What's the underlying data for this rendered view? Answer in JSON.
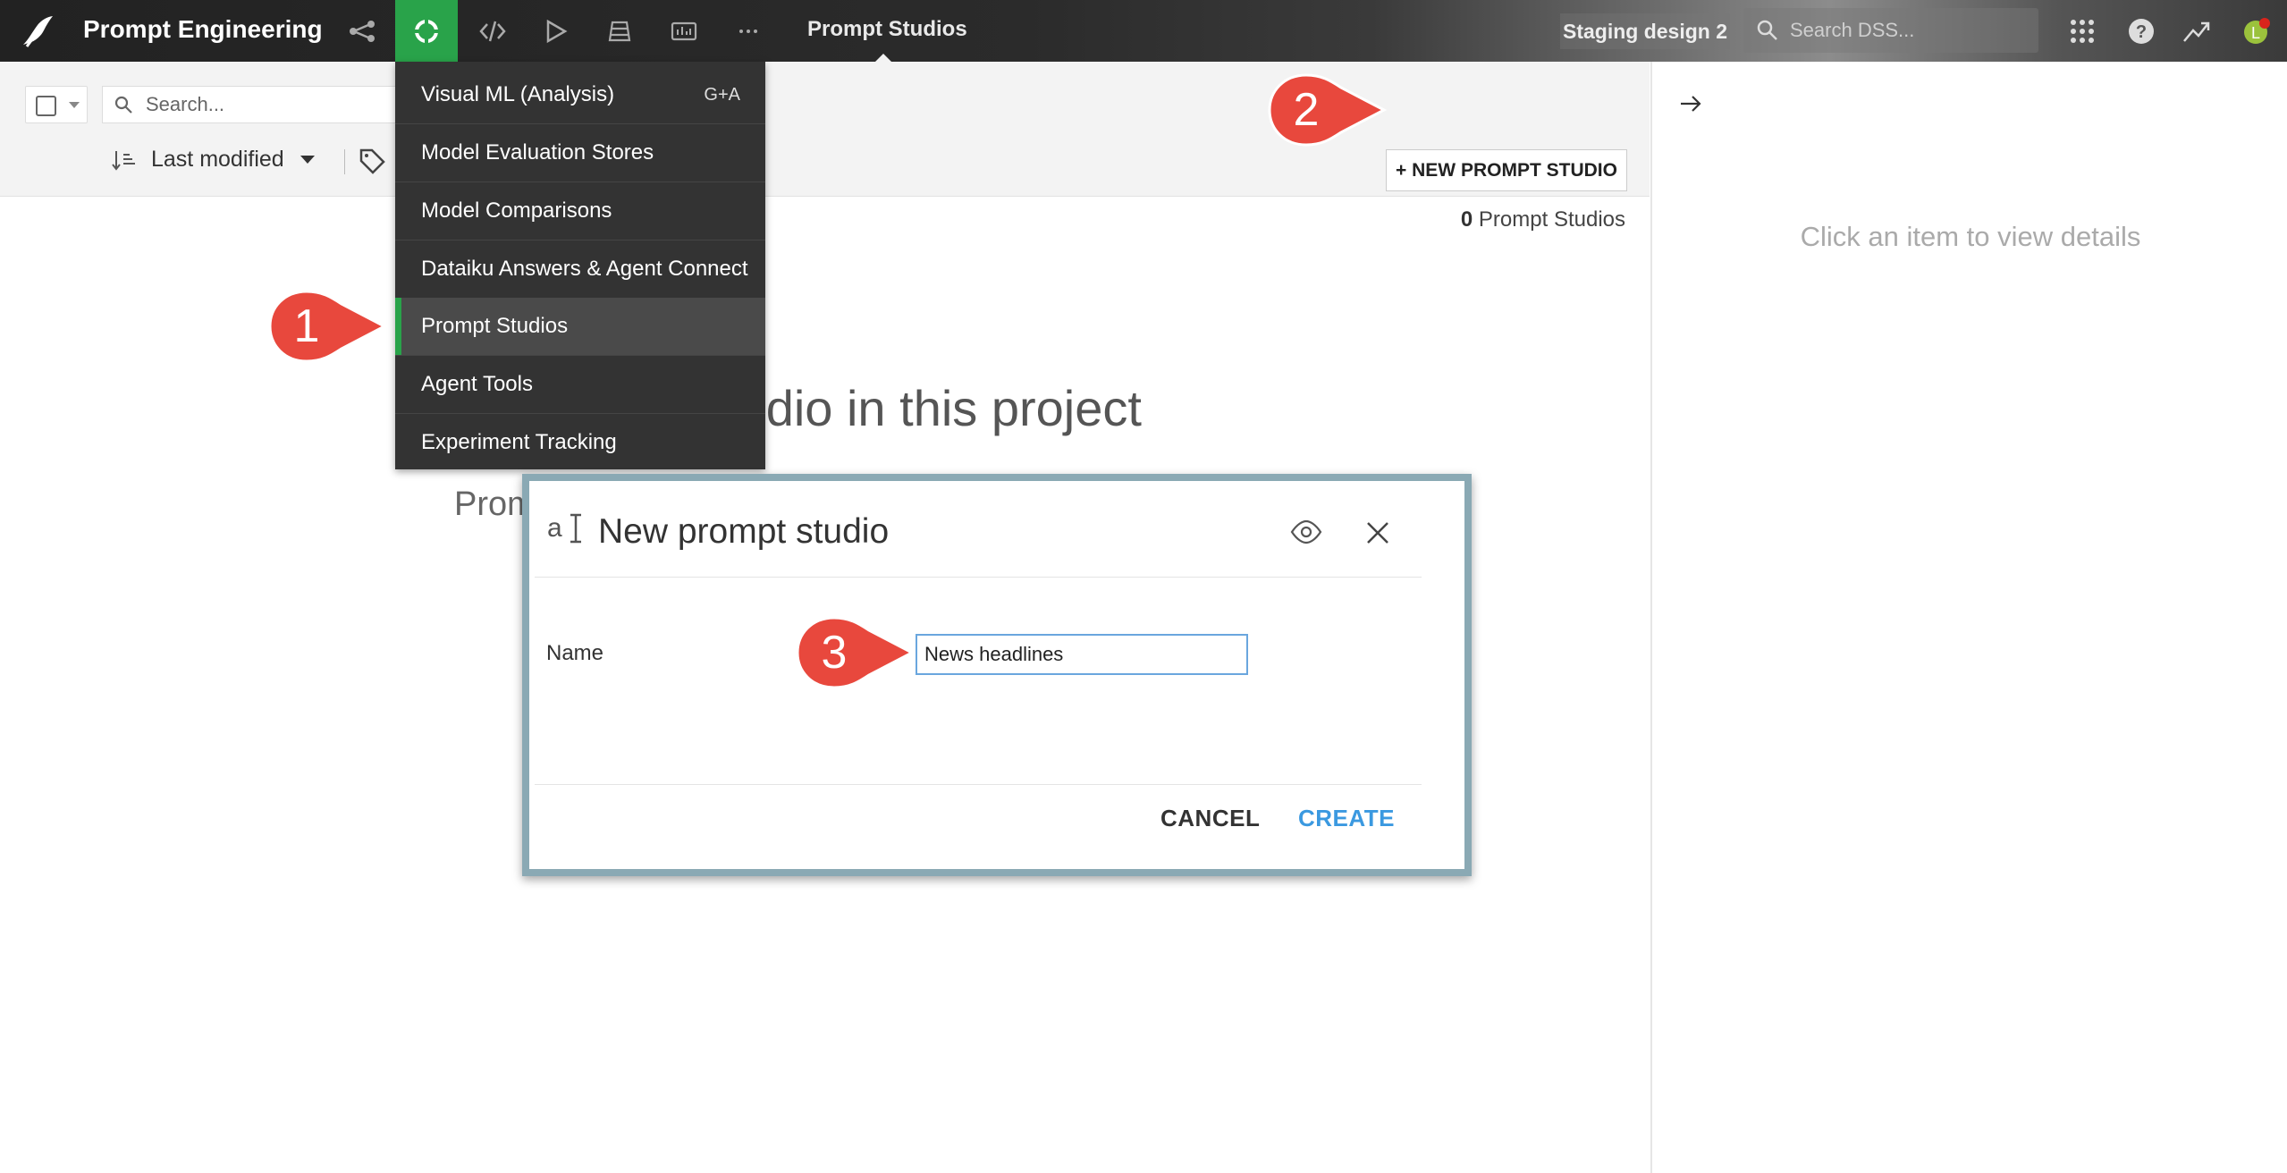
{
  "app": {
    "project_title": "Prompt Engineering",
    "section_title": "Prompt Studios",
    "instance_name": "Staging design 2",
    "search_placeholder": "Search DSS..."
  },
  "toolbar": {
    "search_placeholder": "Search...",
    "sort_label": "Last modified",
    "new_button_label": "+ NEW PROMPT STUDIO",
    "count_value": "0",
    "count_label": "Prompt Studios"
  },
  "empty_state": {
    "heading_visible": "tudio in this project",
    "sub_visible": "Prom"
  },
  "right_panel": {
    "hint": "Click an item to view details"
  },
  "menu": {
    "items": [
      {
        "label": "Visual ML (Analysis)",
        "shortcut": "G+A"
      },
      {
        "label": "Model Evaluation Stores"
      },
      {
        "label": "Model Comparisons"
      },
      {
        "label": "Dataiku Answers & Agent Connect"
      },
      {
        "label": "Prompt Studios",
        "active": true
      },
      {
        "label": "Agent Tools"
      },
      {
        "label": "Experiment Tracking"
      }
    ]
  },
  "modal": {
    "title": "New prompt studio",
    "name_label": "Name",
    "name_value": "News headlines",
    "cancel_label": "CANCEL",
    "create_label": "CREATE"
  },
  "callouts": {
    "one": "1",
    "two": "2",
    "three": "3"
  },
  "colors": {
    "accent_green": "#29a34a",
    "callout_red": "#e8483d",
    "link_blue": "#3b99e0",
    "menu_bg": "#333333"
  },
  "icons": [
    "app-logo-icon",
    "flow-icon",
    "lab-icon",
    "code-icon",
    "run-icon",
    "deploy-icon",
    "dashboard-icon",
    "more-icon",
    "search-icon",
    "apps-grid-icon",
    "help-icon",
    "trend-icon",
    "user-avatar-icon",
    "sort-icon",
    "tag-icon",
    "arrow-right-icon",
    "prompt-studio-icon",
    "eye-icon",
    "close-icon"
  ]
}
